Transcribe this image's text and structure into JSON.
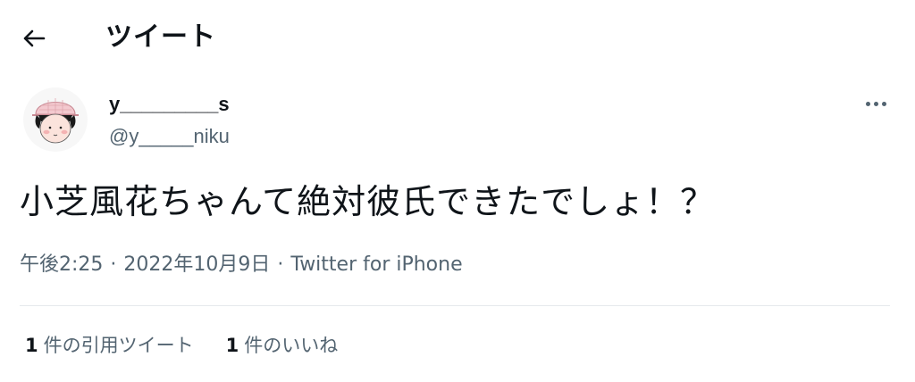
{
  "header": {
    "title": "ツイート",
    "back_icon": "arrow-left-icon"
  },
  "tweet": {
    "author": {
      "display_name": "y_________s",
      "handle": "@y_____niku",
      "avatar_icon": "cartoon-avatar"
    },
    "more_icon": "more-horizontal-icon",
    "text": "小芝風花ちゃんて絶対彼氏できたでしょ！？",
    "meta": {
      "time": "午後2:25",
      "separator": "·",
      "date": "2022年10月9日",
      "source": "Twitter for iPhone"
    },
    "stats": {
      "quotes_count": "1",
      "quotes_label": "件の引用ツイート",
      "likes_count": "1",
      "likes_label": "件のいいね"
    }
  },
  "colors": {
    "text_primary": "#0f1419",
    "text_secondary": "#536471",
    "divider": "#e6e9ec",
    "background": "#ffffff"
  }
}
